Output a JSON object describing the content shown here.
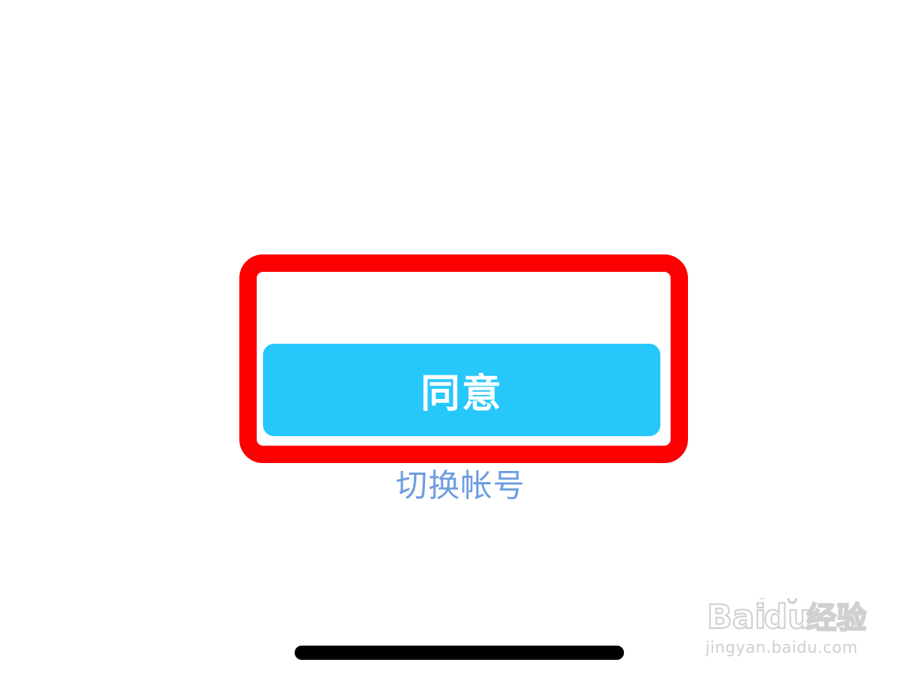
{
  "dialog": {
    "agree_label": "同意",
    "switch_account_label": "切换帐号"
  },
  "watermark": {
    "brand": "Baidu经验",
    "url": "jingyan.baidu.com"
  },
  "colors": {
    "agree_button_bg": "#26c7fb",
    "link_text": "#6f9de0",
    "highlight": "#fb0102"
  }
}
